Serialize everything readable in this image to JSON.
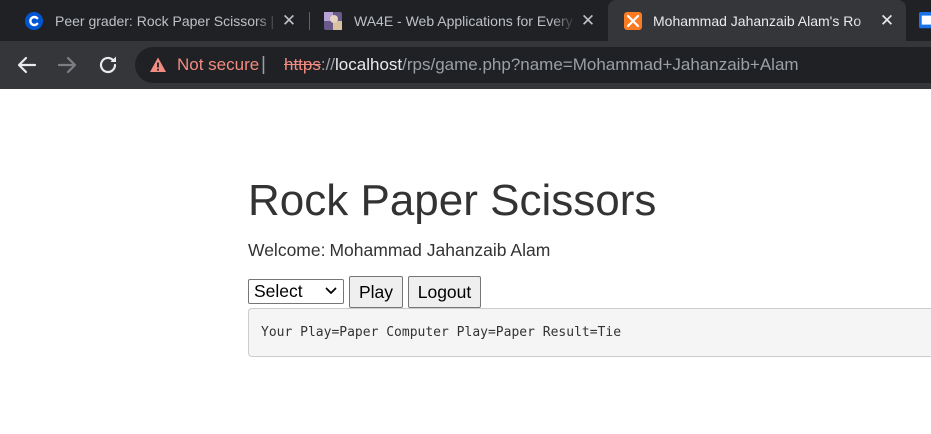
{
  "browser": {
    "tabs": [
      {
        "title": "Peer grader: Rock Paper Scissors | ",
        "favicon": "coursera-icon",
        "active": false
      },
      {
        "title": "WA4E - Web Applications for Every",
        "favicon": "wa4e-icon",
        "active": false
      },
      {
        "title": "Mohammad Jahanzaib Alam's Ro",
        "favicon": "xampp-icon",
        "active": true
      }
    ],
    "security_label": "Not secure",
    "divider": "|",
    "url": {
      "scheme": "https",
      "separator": "://",
      "host": "localhost",
      "path": "/rps/game.php?name=Mohammad+Jahanzaib+Alam"
    },
    "colors": {
      "tabstrip": "#202124",
      "toolbar": "#35363a",
      "warning": "#f28b82",
      "coursera": "#0056d2",
      "xampp": "#fb7a24"
    }
  },
  "page": {
    "heading": "Rock Paper Scissors",
    "welcome_label": "Welcome:",
    "user_name": "Mohammad Jahanzaib Alam",
    "select": {
      "selected": "Select"
    },
    "play_button": "Play",
    "logout_button": "Logout",
    "result_text": "Your Play=Paper Computer Play=Paper Result=Tie"
  }
}
